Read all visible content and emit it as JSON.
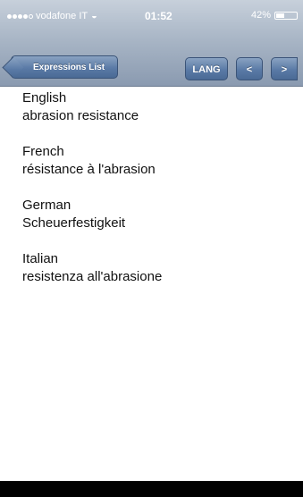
{
  "status_bar": {
    "carrier": "vodafone IT",
    "wifi_icon": "wifi-icon",
    "time": "01:52",
    "battery": "42%",
    "battery_level": 0.42
  },
  "nav": {
    "back_label": "Expressions List",
    "lang_label": "LANG",
    "prev_label": "<",
    "next_label": ">"
  },
  "translations": [
    {
      "language": "English",
      "text": "abrasion resistance"
    },
    {
      "language": "French",
      "text": "résistance à l'abrasion"
    },
    {
      "language": "German",
      "text": "Scheuerfestigkeit"
    },
    {
      "language": "Italian",
      "text": "resistenza all'abrasione"
    }
  ]
}
